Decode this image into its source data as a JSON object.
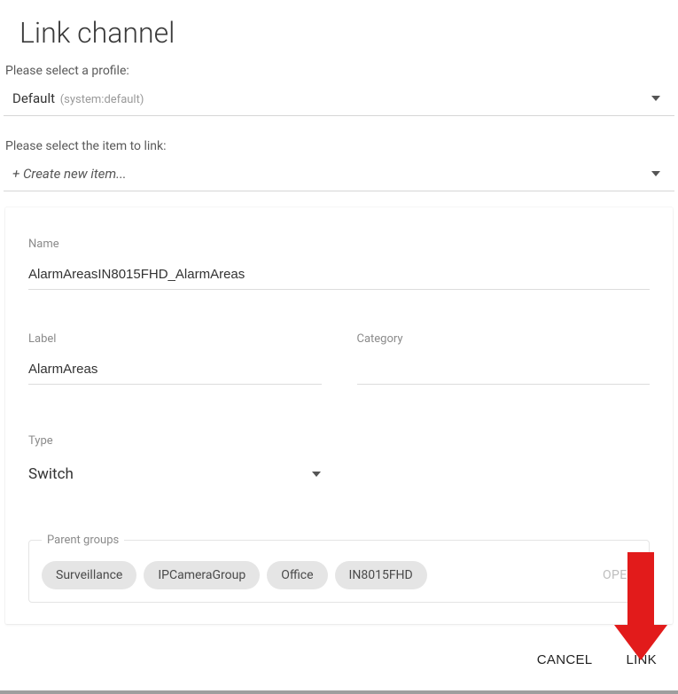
{
  "title": "Link channel",
  "profile_section": {
    "label": "Please select a profile:",
    "selected_name": "Default",
    "selected_detail": "(system:default)"
  },
  "item_section": {
    "label": "Please select the item to link:",
    "selected": "+ Create new item..."
  },
  "form": {
    "name_label": "Name",
    "name_value": "AlarmAreasIN8015FHD_AlarmAreas",
    "label_label": "Label",
    "label_value": "AlarmAreas",
    "category_label": "Category",
    "category_value": "",
    "type_label": "Type",
    "type_value": "Switch",
    "parent_legend": "Parent groups",
    "parent_chips": [
      "Surveillance",
      "IPCameraGroup",
      "Office",
      "IN8015FHD"
    ],
    "open_text": "OPEN"
  },
  "actions": {
    "cancel": "CANCEL",
    "link": "LINK"
  }
}
